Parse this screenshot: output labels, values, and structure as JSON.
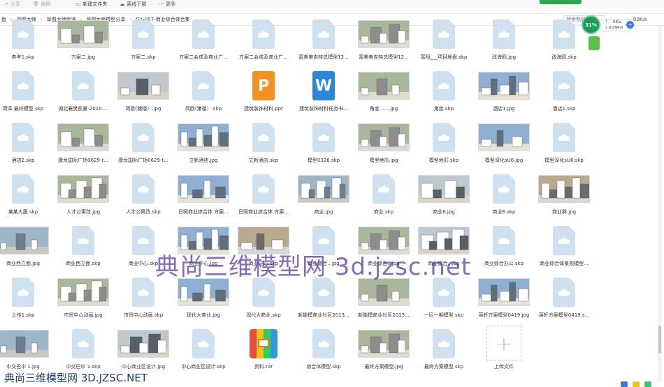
{
  "toolbar": {
    "share_label": "分享",
    "delete_label": "删除",
    "new_folder_label": "新建文件夹",
    "offline_download_label": "离线下载",
    "more_label": "更多"
  },
  "breadcrumb": {
    "items": [
      "盘",
      "草图大师",
      "草图大师资源",
      "草图大师模型分享",
      "GA-007-商业综合体合集"
    ]
  },
  "search": {
    "placeholder": "搜索我的"
  },
  "speed": {
    "percent": "31%",
    "upload": "0K/s",
    "download": "0.09K/s",
    "right_text": "00K/s"
  },
  "files": [
    {
      "name": "参考1.skp",
      "kind": "file"
    },
    {
      "name": "方案二.jpg",
      "kind": "img"
    },
    {
      "name": "方案二.skp",
      "kind": "file"
    },
    {
      "name": "方案二会成及商业广...",
      "kind": "file"
    },
    {
      "name": "方案二会成及商业广...",
      "kind": "file"
    },
    {
      "name": "富美美吉特总模型12...",
      "kind": "file"
    },
    {
      "name": "富美美吉特总模型12...",
      "kind": "img"
    },
    {
      "name": "富阳___项目地盘.skp",
      "kind": "file"
    },
    {
      "name": "改海鸥.jpg",
      "kind": "file"
    },
    {
      "name": "改海鸥.skp",
      "kind": "file"
    },
    {
      "name": "菏泽 最终模型.skp",
      "kind": "file"
    },
    {
      "name": "湖北襄樊凯夏-2010....",
      "kind": "file"
    },
    {
      "name": "简欧(猪楼）.jpg",
      "kind": "img"
    },
    {
      "name": "简欧(猪楼）.skp",
      "kind": "file"
    },
    {
      "name": "建筑装饰材料.ppt",
      "kind": "ppt"
    },
    {
      "name": "建筑装饰材料任务书...",
      "kind": "doc"
    },
    {
      "name": "角度.......jpg",
      "kind": "img"
    },
    {
      "name": "角度.skp",
      "kind": "file"
    },
    {
      "name": "酒店1.jpg",
      "kind": "img"
    },
    {
      "name": "酒店1.skp",
      "kind": "file"
    },
    {
      "name": "酒店2.skp",
      "kind": "file"
    },
    {
      "name": "康龙国际广场0629-t...",
      "kind": "img"
    },
    {
      "name": "康龙国际广场0629-t...",
      "kind": "file"
    },
    {
      "name": "立新酒店.jpg",
      "kind": "img"
    },
    {
      "name": "立新酒店.skp",
      "kind": "file"
    },
    {
      "name": "模型0326.skp",
      "kind": "file"
    },
    {
      "name": "模型地形.jpg",
      "kind": "img"
    },
    {
      "name": "模型地形.skp",
      "kind": "file"
    },
    {
      "name": "模型深化sU6.jpg",
      "kind": "img"
    },
    {
      "name": "模型深化sU6.skp",
      "kind": "file"
    },
    {
      "name": "某某大厦.skp",
      "kind": "file"
    },
    {
      "name": "人才公寓改.jpg",
      "kind": "img"
    },
    {
      "name": "人才公寓改.skp",
      "kind": "file"
    },
    {
      "name": "日照商业综合体 方案...",
      "kind": "img"
    },
    {
      "name": "日照商业综合体 方案...",
      "kind": "file"
    },
    {
      "name": "商业.jpg",
      "kind": "img"
    },
    {
      "name": "商业.skp",
      "kind": "file"
    },
    {
      "name": "商业6.jpg",
      "kind": "img"
    },
    {
      "name": "商业6.skp",
      "kind": "file"
    },
    {
      "name": "商业群.jpg",
      "kind": "img"
    },
    {
      "name": "商业西立面.jpg",
      "kind": "img"
    },
    {
      "name": "商业西立面.skp",
      "kind": "file"
    },
    {
      "name": "商业中心.skp",
      "kind": "file"
    },
    {
      "name": "商业中心.jpg",
      "kind": "img"
    },
    {
      "name": "商业中心.skp",
      "kind": "img"
    },
    {
      "name": "商业综合...jpg",
      "kind": "file"
    },
    {
      "name": "商业综合...jpg",
      "kind": "img"
    },
    {
      "name": "商业综合...jpg",
      "kind": "img"
    },
    {
      "name": "商业综合办公.skp",
      "kind": "file"
    },
    {
      "name": "商业综合体景观模型...",
      "kind": "file"
    },
    {
      "name": "上传1.skp",
      "kind": "file"
    },
    {
      "name": "市贸中心动画.jpg",
      "kind": "img"
    },
    {
      "name": "市贸中心动画.skp",
      "kind": "file"
    },
    {
      "name": "现代大商业.jpg",
      "kind": "img"
    },
    {
      "name": "现代大商业.skp",
      "kind": "file"
    },
    {
      "name": "新能模商业社区2013...",
      "kind": "file"
    },
    {
      "name": "新能模商业社区2013...",
      "kind": "img"
    },
    {
      "name": "一区一期模型.skp",
      "kind": "file"
    },
    {
      "name": "英轩方案模型0419.jpg",
      "kind": "img"
    },
    {
      "name": "英轩方案模型0419.s...",
      "kind": "file"
    },
    {
      "name": "中交巴中 1.jpg",
      "kind": "img"
    },
    {
      "name": "中交巴中 1.skp",
      "kind": "file"
    },
    {
      "name": "中心商业区设计.jpg",
      "kind": "img"
    },
    {
      "name": "中心商业区设计.skp",
      "kind": "file"
    },
    {
      "name": "资料.rar",
      "kind": "rar"
    },
    {
      "name": "综合体模型.skp",
      "kind": "file"
    },
    {
      "name": "最终方案模型.jpg",
      "kind": "img"
    },
    {
      "name": "最终方案模型.skp",
      "kind": "file"
    },
    {
      "name": "上传文件",
      "kind": "upload"
    }
  ],
  "watermarks": {
    "center": "典尚三维模型网 3d.jzsc.net",
    "bottom": "典尚三维模型网 3D.JZSC.NET"
  },
  "colors": {
    "file_icon": "#cfe0ef",
    "ppt": "#f39222",
    "doc": "#2b88d9",
    "accent_green": "#1f9a5a",
    "watermark": "#5b3ca6"
  }
}
